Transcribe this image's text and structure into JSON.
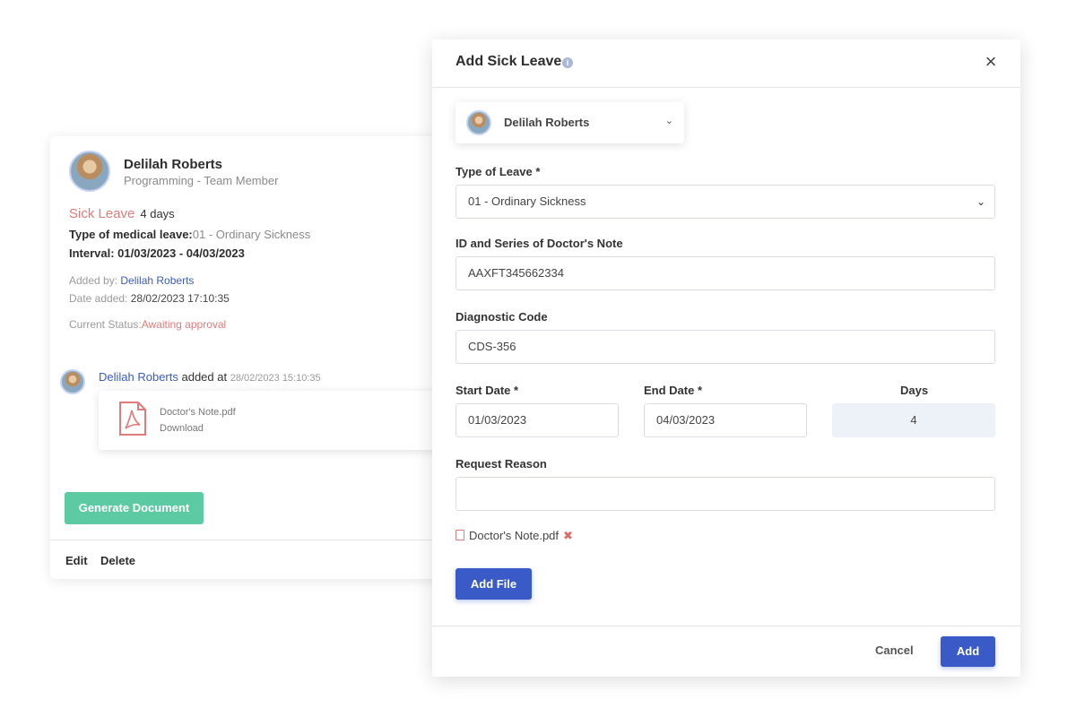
{
  "card": {
    "name": "Delilah Roberts",
    "role": "Programming - Team Member",
    "leave_type": "Sick Leave",
    "leave_days": "4 days",
    "medical_label": "Type of medical leave:",
    "medical_value": "01 - Ordinary Sickness",
    "interval": "Interval: 01/03/2023 - 04/03/2023",
    "added_by_label": "Added by: ",
    "added_by_value": "Delilah Roberts",
    "date_added_label": "Date added: ",
    "date_added_value": "28/02/2023 17:10:35",
    "status_label": "Current Status:",
    "status_value": "Awaiting approval",
    "comment_author": "Delilah Roberts",
    "comment_action": " added at ",
    "comment_time": "28/02/2023 15:10:35",
    "file_name": "Doctor's Note.pdf",
    "file_download": "Download",
    "generate_label": "Generate Document",
    "edit_label": "Edit",
    "delete_label": "Delete"
  },
  "modal": {
    "title": "Add Sick Leave",
    "employee": "Delilah Roberts",
    "type_label": "Type of Leave *",
    "type_value": "01 - Ordinary Sickness",
    "note_label": "ID and Series of Doctor's Note",
    "note_value": "AAXFT345662334",
    "diag_label": "Diagnostic Code",
    "diag_value": "CDS-356",
    "start_label": "Start Date *",
    "start_value": "01/03/2023",
    "end_label": "End Date *",
    "end_value": "04/03/2023",
    "days_label": "Days",
    "days_value": "4",
    "reason_label": "Request Reason",
    "reason_value": "",
    "attachment": "Doctor's Note.pdf",
    "add_file_label": "Add File",
    "cancel_label": "Cancel",
    "add_label": "Add"
  },
  "colors": {
    "accent_blue": "#3a5bc7",
    "sick_red": "#e07b7b",
    "generate_green": "#5ccaa2"
  },
  "icons": [
    "info-icon",
    "close-icon",
    "chevron-down-icon",
    "pdf-icon",
    "file-icon",
    "remove-icon"
  ]
}
